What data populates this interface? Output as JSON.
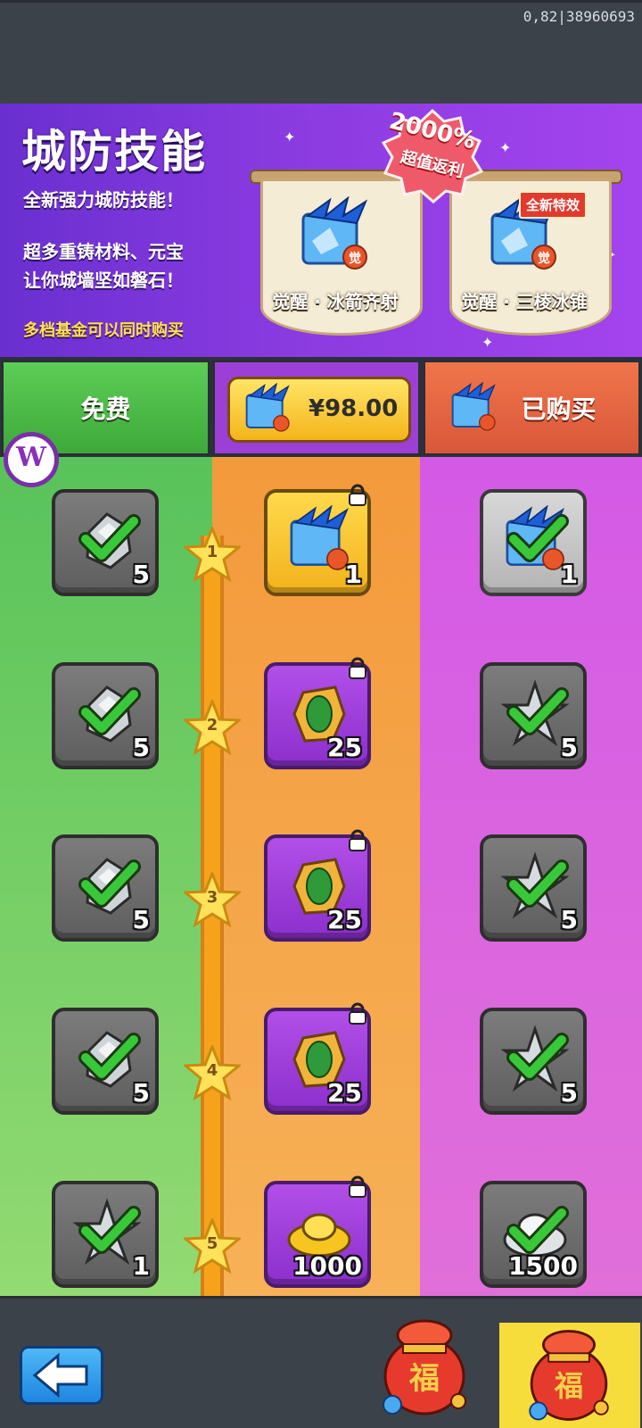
{
  "status": {
    "debug_text": "0,82|38960693"
  },
  "banner": {
    "title": "城防技能",
    "subtitle": "全新强力城防技能！",
    "description": "超多重铸材料、元宝\n让你城墙坚如磐石！",
    "note": "多档基金可以同时购买",
    "promo_percent": "2000%",
    "promo_label": "超值返利",
    "new_effect_badge": "全新特效",
    "skills": [
      {
        "name": "觉醒·冰箭齐射",
        "caption": "觉醒 · 冰箭齐射"
      },
      {
        "name": "觉醒·三棱冰锥",
        "caption": "觉醒 · 三棱冰锥"
      }
    ],
    "skill_badge": "觉"
  },
  "tabs": {
    "free": "免费",
    "price": "¥98.00",
    "bought": "已购买"
  },
  "levels": [
    "1",
    "2",
    "3",
    "4",
    "5"
  ],
  "rows": [
    {
      "free": {
        "item": "ore",
        "qty": "5",
        "claimed": true
      },
      "paid": {
        "item": "skill-scroll",
        "qty": "1",
        "locked": true
      },
      "premium": {
        "item": "skill-scroll",
        "qty": "1",
        "claimed": true
      }
    },
    {
      "free": {
        "item": "ore",
        "qty": "5",
        "claimed": true
      },
      "paid": {
        "item": "green-gem",
        "qty": "25",
        "locked": true
      },
      "premium": {
        "item": "shuriken",
        "qty": "5",
        "claimed": true
      }
    },
    {
      "free": {
        "item": "ore",
        "qty": "5",
        "claimed": true
      },
      "paid": {
        "item": "green-gem",
        "qty": "25",
        "locked": true
      },
      "premium": {
        "item": "shuriken",
        "qty": "5",
        "claimed": true
      }
    },
    {
      "free": {
        "item": "ore",
        "qty": "5",
        "claimed": true
      },
      "paid": {
        "item": "green-gem",
        "qty": "25",
        "locked": true
      },
      "premium": {
        "item": "shuriken",
        "qty": "5",
        "claimed": true
      }
    },
    {
      "free": {
        "item": "shuriken",
        "qty": "1",
        "claimed": true
      },
      "paid": {
        "item": "gold-ingot",
        "qty": "1000",
        "locked": true
      },
      "premium": {
        "item": "silver-ingot",
        "qty": "1500",
        "claimed": true
      }
    }
  ],
  "colors": {
    "free": "#58c35a",
    "paid": "#f39a3c",
    "premium": "#d45ae6",
    "track": "#f6a21b",
    "accent_yellow": "#f7dd3b"
  },
  "icons": {
    "back": "back-arrow-icon",
    "lock": "lock-icon",
    "check": "checkmark-icon",
    "bag": "treasure-bag-icon"
  }
}
